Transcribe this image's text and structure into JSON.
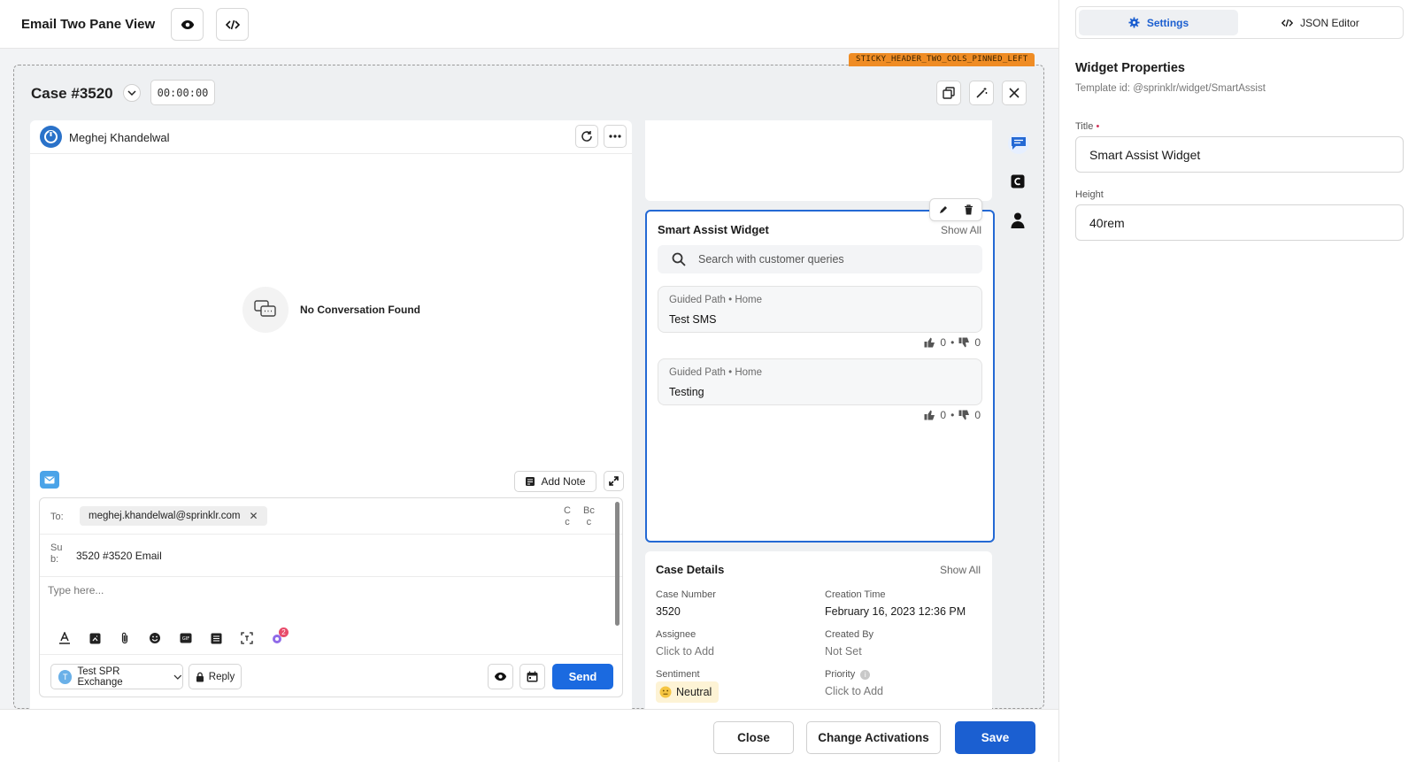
{
  "header": {
    "title": "Email Two Pane View"
  },
  "tag": "STICKY_HEADER_TWO_COLS_PINNED_LEFT",
  "case": {
    "title": "Case #3520",
    "timer": "00:00:00"
  },
  "conversation": {
    "user_name": "Meghej Khandelwal",
    "empty_text": "No Conversation Found",
    "add_note_label": "Add Note",
    "to_label": "To:",
    "to_email": "meghej.khandelwal@sprinklr.com",
    "cc_label": "C\nc",
    "bcc_label": "Bc\nc",
    "sub_label": "Su\nb:",
    "subject": "3520 #3520 Email",
    "body_placeholder": "Type here...",
    "account_label": "Test SPR Exchange",
    "account_initial": "T",
    "reply_label": "Reply",
    "send_label": "Send",
    "ai_badge": "2"
  },
  "smart_assist": {
    "title": "Smart Assist Widget",
    "show_all": "Show All",
    "search_placeholder": "Search with customer queries",
    "cards": [
      {
        "path": "Guided Path",
        "section": "Home",
        "title": "Test SMS",
        "likes": "0",
        "dislikes": "0"
      },
      {
        "path": "Guided Path",
        "section": "Home",
        "title": "Testing",
        "likes": "0",
        "dislikes": "0"
      }
    ]
  },
  "case_details": {
    "title": "Case Details",
    "show_all": "Show All",
    "fields": {
      "case_number_label": "Case Number",
      "case_number": "3520",
      "creation_time_label": "Creation Time",
      "creation_time": "February 16, 2023 12:36 PM",
      "assignee_label": "Assignee",
      "assignee": "Click to Add",
      "created_by_label": "Created By",
      "created_by": "Not Set",
      "sentiment_label": "Sentiment",
      "sentiment": "Neutral",
      "priority_label": "Priority",
      "priority": "Click to Add"
    }
  },
  "footer": {
    "close": "Close",
    "change_activations": "Change Activations",
    "save": "Save"
  },
  "right_panel": {
    "tabs": [
      "Settings",
      "JSON Editor"
    ],
    "heading": "Widget Properties",
    "template_id": "Template id: @sprinklr/widget/SmartAssist",
    "title_label": "Title",
    "title_value": "Smart Assist Widget",
    "height_label": "Height",
    "height_value": "40rem"
  },
  "colors": {
    "accent": "#1b6ae0",
    "tag": "#ef8c24",
    "selection": "#2469d4"
  }
}
